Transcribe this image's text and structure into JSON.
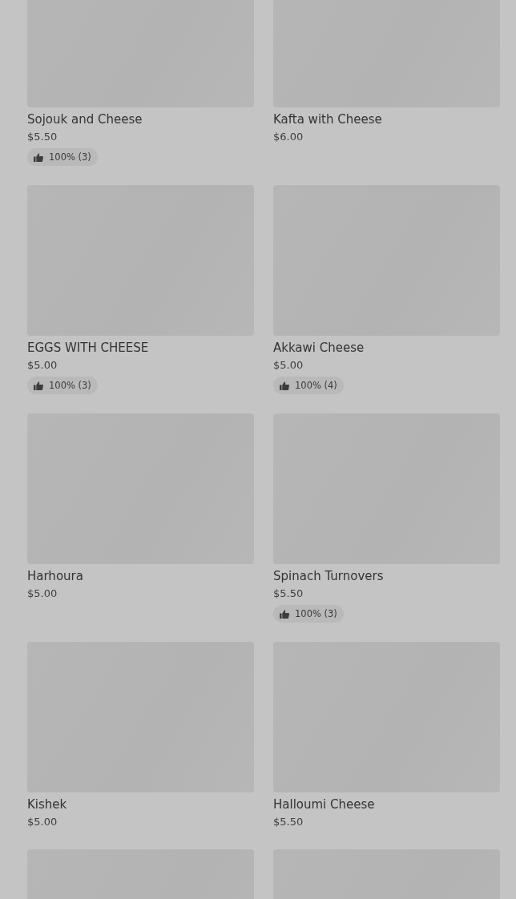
{
  "products": [
    {
      "kind": "product",
      "name": "Sojouk and Cheese",
      "price": "$5.50",
      "rating": "100% (3)"
    },
    {
      "kind": "product",
      "name": "Kafta with Cheese",
      "price": "$6.00"
    },
    {
      "kind": "product",
      "name": "EGGS WITH CHEESE",
      "price": "$5.00",
      "rating": "100% (3)"
    },
    {
      "kind": "product",
      "name": "Akkawi Cheese",
      "price": "$5.00",
      "rating": "100% (4)"
    },
    {
      "kind": "product",
      "name": "Harhoura",
      "price": "$5.00"
    },
    {
      "kind": "product",
      "name": "Spinach Turnovers",
      "price": "$5.50",
      "rating": "100% (3)"
    },
    {
      "kind": "product",
      "name": "Kishek",
      "price": "$5.00"
    },
    {
      "kind": "product",
      "name": "Halloumi Cheese",
      "price": "$5.50"
    },
    {
      "kind": "product"
    },
    {
      "kind": "product"
    }
  ]
}
